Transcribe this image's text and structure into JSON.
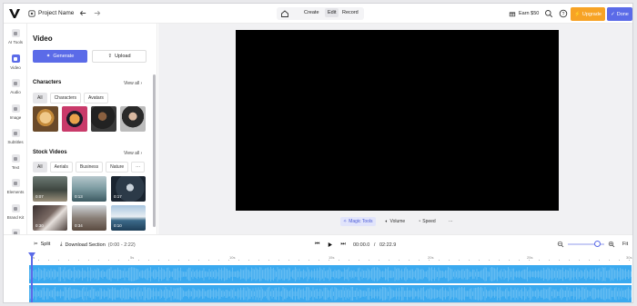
{
  "topbar": {
    "project_name": "Project Name",
    "tabs": [
      "Create",
      "Edit",
      "Record"
    ],
    "active_tab": "Edit",
    "earn_label": "Earn $50",
    "upgrade_label": "Upgrade",
    "done_label": "Done",
    "colors": {
      "upgrade": "#f7a325",
      "done": "#5b6be8"
    }
  },
  "rail": {
    "items": [
      {
        "label": "AI Tools",
        "icon": "ai-tools-icon"
      },
      {
        "label": "Video",
        "icon": "video-icon",
        "active": true
      },
      {
        "label": "Audio",
        "icon": "audio-icon"
      },
      {
        "label": "Image",
        "icon": "image-icon"
      },
      {
        "label": "Subtitles",
        "icon": "subtitles-icon"
      },
      {
        "label": "Text",
        "icon": "text-icon"
      },
      {
        "label": "Elements",
        "icon": "elements-icon"
      },
      {
        "label": "Brand Kit",
        "icon": "brand-kit-icon"
      },
      {
        "label": "Settings",
        "icon": "settings-icon"
      }
    ]
  },
  "panel": {
    "title": "Video",
    "generate_label": "Generate",
    "upload_label": "Upload",
    "characters": {
      "title": "Characters",
      "view_all": "View all",
      "chips": [
        "All",
        "Characters",
        "Avatars"
      ]
    },
    "stock": {
      "title": "Stock Videos",
      "view_all": "View all",
      "chips": [
        "All",
        "Aerials",
        "Business",
        "Nature",
        "···"
      ],
      "durations": [
        "0:07",
        "0:13",
        "0:17",
        "0:30",
        "0:34",
        "0:10"
      ]
    }
  },
  "stage": {
    "tools": [
      "Magic Tools",
      "Volume",
      "Speed",
      "···"
    ]
  },
  "timeline": {
    "split_label": "Split",
    "download_label": "Download Section",
    "download_range": "(0:00 - 2:22)",
    "current_time": "00:00.0",
    "separator": "/",
    "total_time": "02:22.9",
    "fit_label": "Fit",
    "ruler_ticks": [
      "0s",
      "5s",
      "10s",
      "15s",
      "20s",
      "25s",
      "30s"
    ],
    "zoom_level": 0.75
  }
}
